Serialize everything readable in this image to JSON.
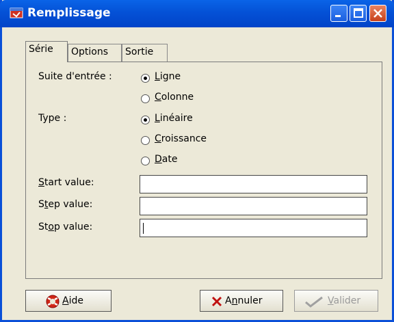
{
  "window": {
    "title": "Remplissage"
  },
  "tabs": [
    {
      "label": "Série",
      "active": true
    },
    {
      "label": "Options",
      "active": false
    },
    {
      "label": "Sortie",
      "active": false
    }
  ],
  "suite": {
    "label": "Suite d'entrée :",
    "options": [
      {
        "label": "Ligne",
        "accel": "L",
        "rest": "igne",
        "checked": true
      },
      {
        "label": "Colonne",
        "accel": "C",
        "rest": "olonne",
        "checked": false
      }
    ]
  },
  "type": {
    "label": "Type :",
    "options": [
      {
        "label": "Linéaire",
        "accel": "L",
        "rest": "inéaire",
        "checked": true
      },
      {
        "label": "Croissance",
        "accel": "C",
        "rest": "roissance",
        "checked": false
      },
      {
        "label": "Date",
        "accel": "D",
        "rest": "ate",
        "checked": false
      }
    ]
  },
  "fields": [
    {
      "label": "Start value:",
      "accel": "S",
      "rest": "tart value:",
      "value": ""
    },
    {
      "label": "Step value:",
      "pre": "S",
      "accel": "t",
      "rest": "ep value:",
      "value": ""
    },
    {
      "label": "Stop value:",
      "pre": "St",
      "accel": "o",
      "rest": "p value:",
      "value": ""
    }
  ],
  "buttons": {
    "help": {
      "accel": "A",
      "rest": "ide"
    },
    "cancel": {
      "pre": "A",
      "accel": "n",
      "rest": "nuler"
    },
    "ok": {
      "accel": "V",
      "rest": "alider",
      "enabled": false
    }
  },
  "colors": {
    "titlebar": "#0a50d8",
    "face": "#ece9d8"
  }
}
